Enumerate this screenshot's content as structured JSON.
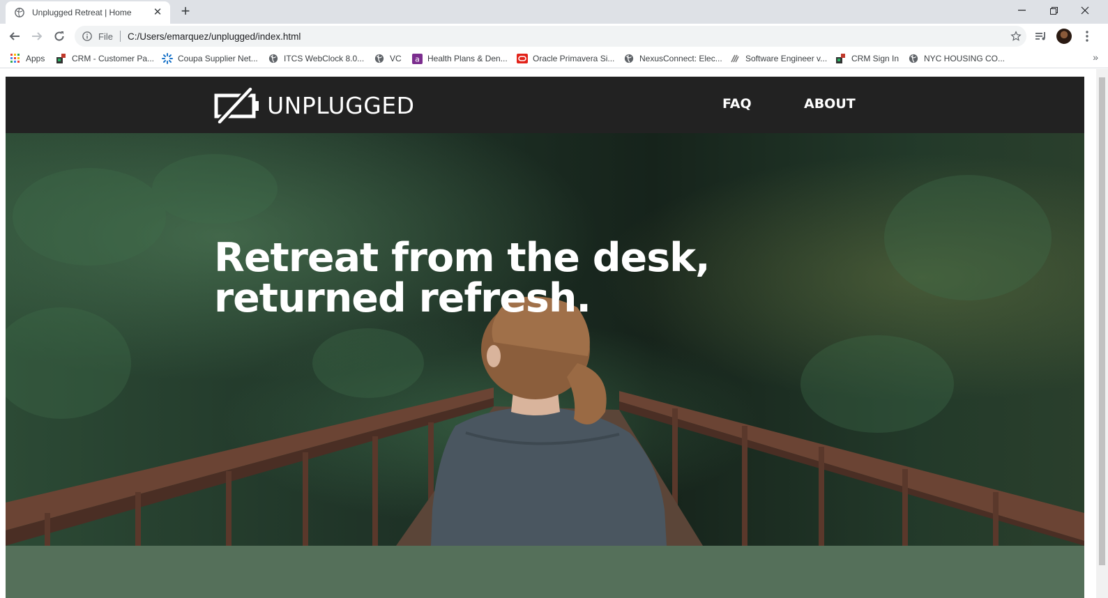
{
  "browser": {
    "tab_title": "Unplugged Retreat | Home",
    "url_scheme": "File",
    "url": "C:/Users/emarquez/unplugged/index.html",
    "bookmarks": [
      {
        "label": "Apps",
        "icon": "apps-grid-icon"
      },
      {
        "label": "CRM - Customer Pa...",
        "icon": "crm-icon"
      },
      {
        "label": "Coupa Supplier Net...",
        "icon": "coupa-icon"
      },
      {
        "label": "ITCS WebClock 8.0...",
        "icon": "globe-icon"
      },
      {
        "label": "VC",
        "icon": "globe-icon"
      },
      {
        "label": "Health Plans & Den...",
        "icon": "aetna-icon"
      },
      {
        "label": "Oracle Primavera Si...",
        "icon": "oracle-icon"
      },
      {
        "label": "NexusConnect: Elec...",
        "icon": "globe-icon"
      },
      {
        "label": "Software Engineer v...",
        "icon": "lever-icon"
      },
      {
        "label": "CRM Sign In",
        "icon": "crm-icon"
      },
      {
        "label": "NYC HOUSING CO...",
        "icon": "globe-icon"
      }
    ]
  },
  "site": {
    "brand": "UNPLUGGED",
    "nav": [
      {
        "label": "FAQ"
      },
      {
        "label": "ABOUT"
      }
    ],
    "hero": {
      "line1": "Retreat from the desk,",
      "line2": "returned refresh."
    },
    "colors": {
      "header_bg": "#222222",
      "band_green": "#55705a",
      "text": "#ffffff"
    }
  }
}
